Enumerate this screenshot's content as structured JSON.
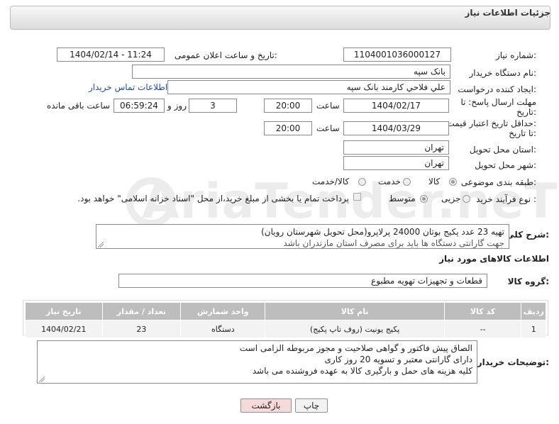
{
  "header": {
    "title": "جزئیات اطلاعات نیاز"
  },
  "watermark": {
    "text": "AriaTender.neT"
  },
  "fields": {
    "need_number_label": "شماره نیاز:",
    "need_number": "1104001036000127",
    "announce_label": "تاریخ و ساعت اعلان عمومی:",
    "announce_value": "1404/02/14 - 11:24",
    "buyer_org_label": "نام دستگاه خریدار:",
    "buyer_org": "بانک سپه",
    "creator_label": "ایجاد کننده درخواست:",
    "creator": "علي فلاحي کارمند بانک سپه",
    "buyer_contact_link": "اطلاعات تماس خریدار",
    "reply_deadline_label_1": "مهلت ارسال پاسخ: تا",
    "reply_deadline_label_2": "تاریخ:",
    "reply_date": "1404/02/17",
    "time_label": "ساعت",
    "reply_time": "20:00",
    "days_value": "3",
    "days_label": "روز و",
    "remaining_time": "06:59:24",
    "remaining_label": "ساعت باقی مانده",
    "price_validity_label_1": "حداقل تاریخ اعتبار قیمت:",
    "price_validity_label_2": "تا تاریخ:",
    "price_date": "1404/03/29",
    "price_time_label": "ساعت",
    "price_time": "20:00",
    "province_label": "استان محل تحویل:",
    "province": "تهران",
    "city_label": "شهر محل تحویل:",
    "city": "تهران",
    "category_label": "طبقه بندی موضوعی:",
    "category_options": [
      "کالا",
      "خدمت",
      "کالا/خدمت"
    ],
    "category_selected": "کالا",
    "process_label": "نوع فرآیند خرید :",
    "process_options": [
      "جزیی",
      "متوسط"
    ],
    "process_selected": "متوسط",
    "payment_note": "پرداخت تمام یا بخشی از مبلغ خرید،از محل \"اسناد خزانه اسلامی\" خواهد بود."
  },
  "description": {
    "label": "شرح کلی نیاز:",
    "line1": "تهیه 23 عدد پکیج بوتان 24000 پرلاپرو(محل تحویل شهرستان رویان)",
    "line2": "جهت گارانتی دستگاه ها باید برای مصرف استان مازندران باشد"
  },
  "goods_section": {
    "title": "اطلاعات کالاهای مورد نیاز",
    "group_label": "گروه کالا:",
    "group_value": "قطعات و تجهیزات تهویه مطبوع"
  },
  "table": {
    "headers": [
      "ردیف",
      "کد کالا",
      "نام کالا",
      "واحد شمارش",
      "تعداد / مقدار",
      "تاریخ نیاز"
    ],
    "rows": [
      {
        "row": "1",
        "code": "--",
        "name": "پکیج یونیت (روف تاپ پکیج)",
        "unit": "دستگاه",
        "qty": "23",
        "date": "1404/02/21"
      }
    ]
  },
  "buyer_notes": {
    "label": "توضیحات خریدار:",
    "line1": "الصاق پیش فاکتور و گواهی صلاحیت و مجوز مربوطه الزامی است",
    "line2": "دارای گارانتی معتبر و تسویه 20 روز کاری",
    "line3": "کلیه هزینه های حمل و بارگیری  کالا به عهده فروشنده می باشد"
  },
  "buttons": {
    "print": "چاپ",
    "back": "بازگشت"
  },
  "colors": {
    "back_button_bg": "#f6dada",
    "print_button_bg": "#f2f2f2",
    "table_header": "#bdbdbd",
    "link": "#1a4fa0"
  }
}
